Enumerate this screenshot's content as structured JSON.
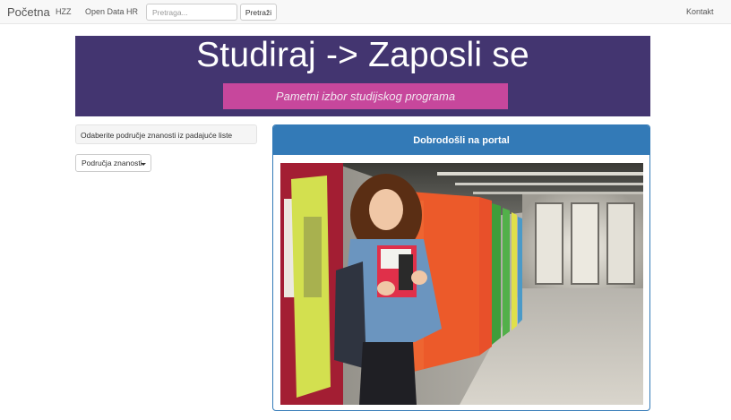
{
  "navbar": {
    "brand": "Početna",
    "links": [
      "HZZ",
      "Open Data HR"
    ],
    "search": {
      "placeholder": "Pretraga...",
      "value": ""
    },
    "search_button": "Pretraži",
    "right_link": "Kontakt"
  },
  "banner": {
    "title": "Studiraj -> Zaposli se",
    "subtitle": "Pametni izbor studijskog programa",
    "bg_color": "#433570",
    "accent_color": "#c7479c"
  },
  "sidebar": {
    "info_text": "Odaberite područje znanosti iz padajuće liste",
    "dropdown_label": "Područja znanosti"
  },
  "panel": {
    "title": "Dobrodošli na portal",
    "heading_color": "#337ab7"
  }
}
